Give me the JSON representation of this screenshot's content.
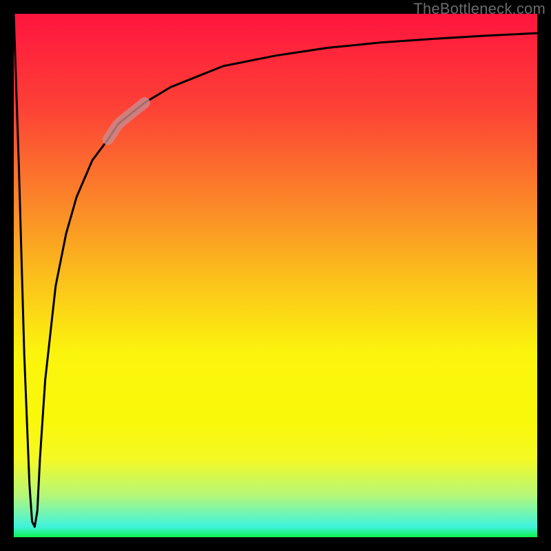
{
  "watermark": "TheBottleneck.com",
  "chart_data": {
    "type": "line",
    "title": "",
    "xlabel": "",
    "ylabel": "",
    "xlim": [
      0,
      100
    ],
    "ylim": [
      0,
      100
    ],
    "grid": false,
    "legend": false,
    "series": [
      {
        "name": "bottleneck-curve",
        "color": "#000000",
        "x": [
          0,
          1,
          2,
          3,
          3.5,
          4,
          4.5,
          5,
          6,
          8,
          10,
          12,
          15,
          18,
          20,
          25,
          30,
          35,
          40,
          50,
          60,
          70,
          80,
          90,
          100
        ],
        "y": [
          100,
          70,
          35,
          10,
          3,
          2,
          5,
          15,
          30,
          48,
          58,
          65,
          72,
          76,
          79,
          83,
          86,
          88,
          90,
          92,
          93.5,
          94.5,
          95.2,
          95.8,
          96.3
        ]
      }
    ],
    "highlight_segment": {
      "x_start": 18,
      "x_end": 25,
      "color": "#c98b8d",
      "opacity": 0.8
    },
    "background_gradient": {
      "type": "vertical",
      "stops": [
        {
          "y": 100,
          "color": "#fe153e"
        },
        {
          "y": 82,
          "color": "#fd4136"
        },
        {
          "y": 62,
          "color": "#fb8e27"
        },
        {
          "y": 48,
          "color": "#fbc61a"
        },
        {
          "y": 35,
          "color": "#fbf50d"
        },
        {
          "y": 22,
          "color": "#faf80a"
        },
        {
          "y": 15,
          "color": "#f4f924"
        },
        {
          "y": 8,
          "color": "#b5f779"
        },
        {
          "y": 2,
          "color": "#3ef3dd"
        },
        {
          "y": 0,
          "color": "#0ef24f"
        }
      ]
    }
  }
}
